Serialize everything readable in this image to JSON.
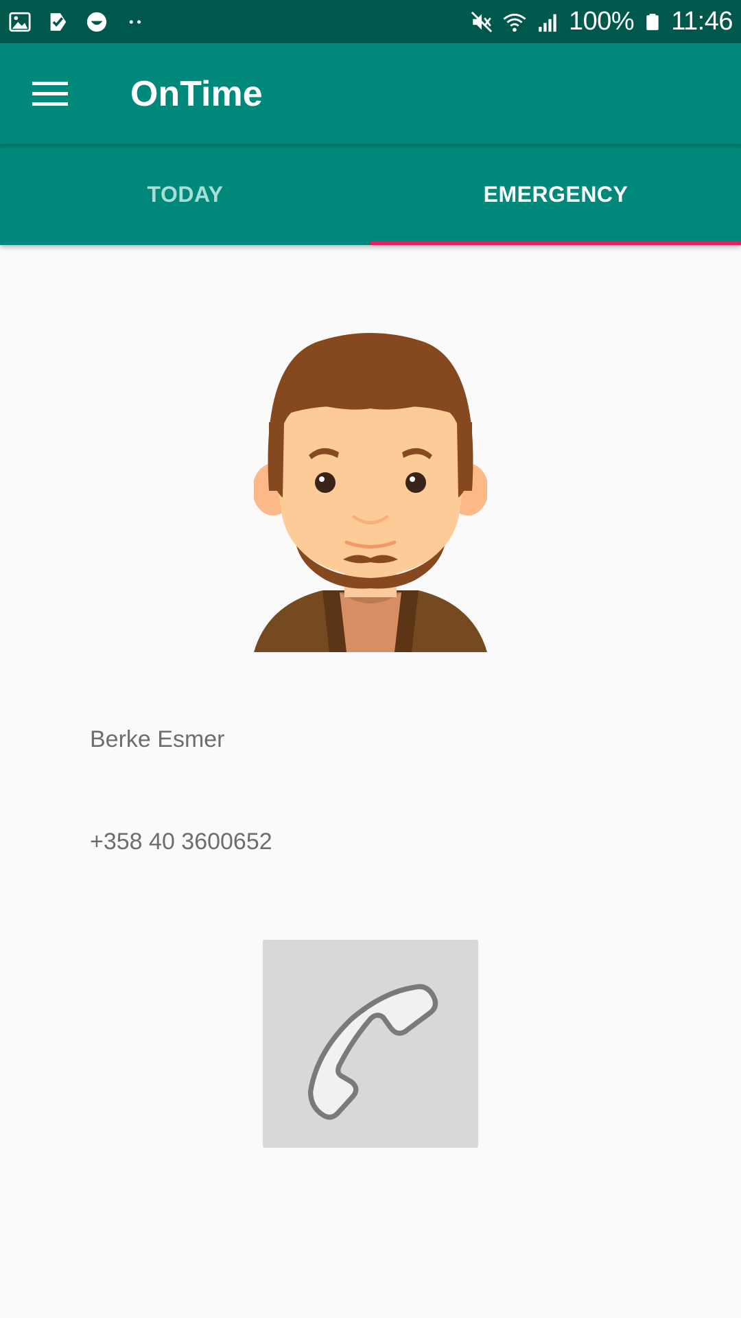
{
  "status_bar": {
    "battery": "100%",
    "time": "11:46",
    "icons": [
      "gallery-icon",
      "check-icon",
      "smile-icon",
      "more-dots-icon",
      "mute-icon",
      "wifi-icon",
      "signal-icon",
      "battery-icon"
    ]
  },
  "app_bar": {
    "title": "OnTime",
    "menu_icon": "hamburger-menu-icon"
  },
  "tabs": [
    {
      "label": "TODAY",
      "active": false
    },
    {
      "label": "EMERGENCY",
      "active": true
    }
  ],
  "contact": {
    "name": "Berke Esmer",
    "phone": "+358 40 3600652",
    "avatar_icon": "avatar-man-icon",
    "call_icon": "phone-handset-icon"
  },
  "colors": {
    "status_bar": "#00574c",
    "primary": "#00897b",
    "tab_indicator": "#e91e63",
    "background": "#fafafa",
    "call_button": "#d7d8d8",
    "text_secondary": "#6d6d6d"
  }
}
